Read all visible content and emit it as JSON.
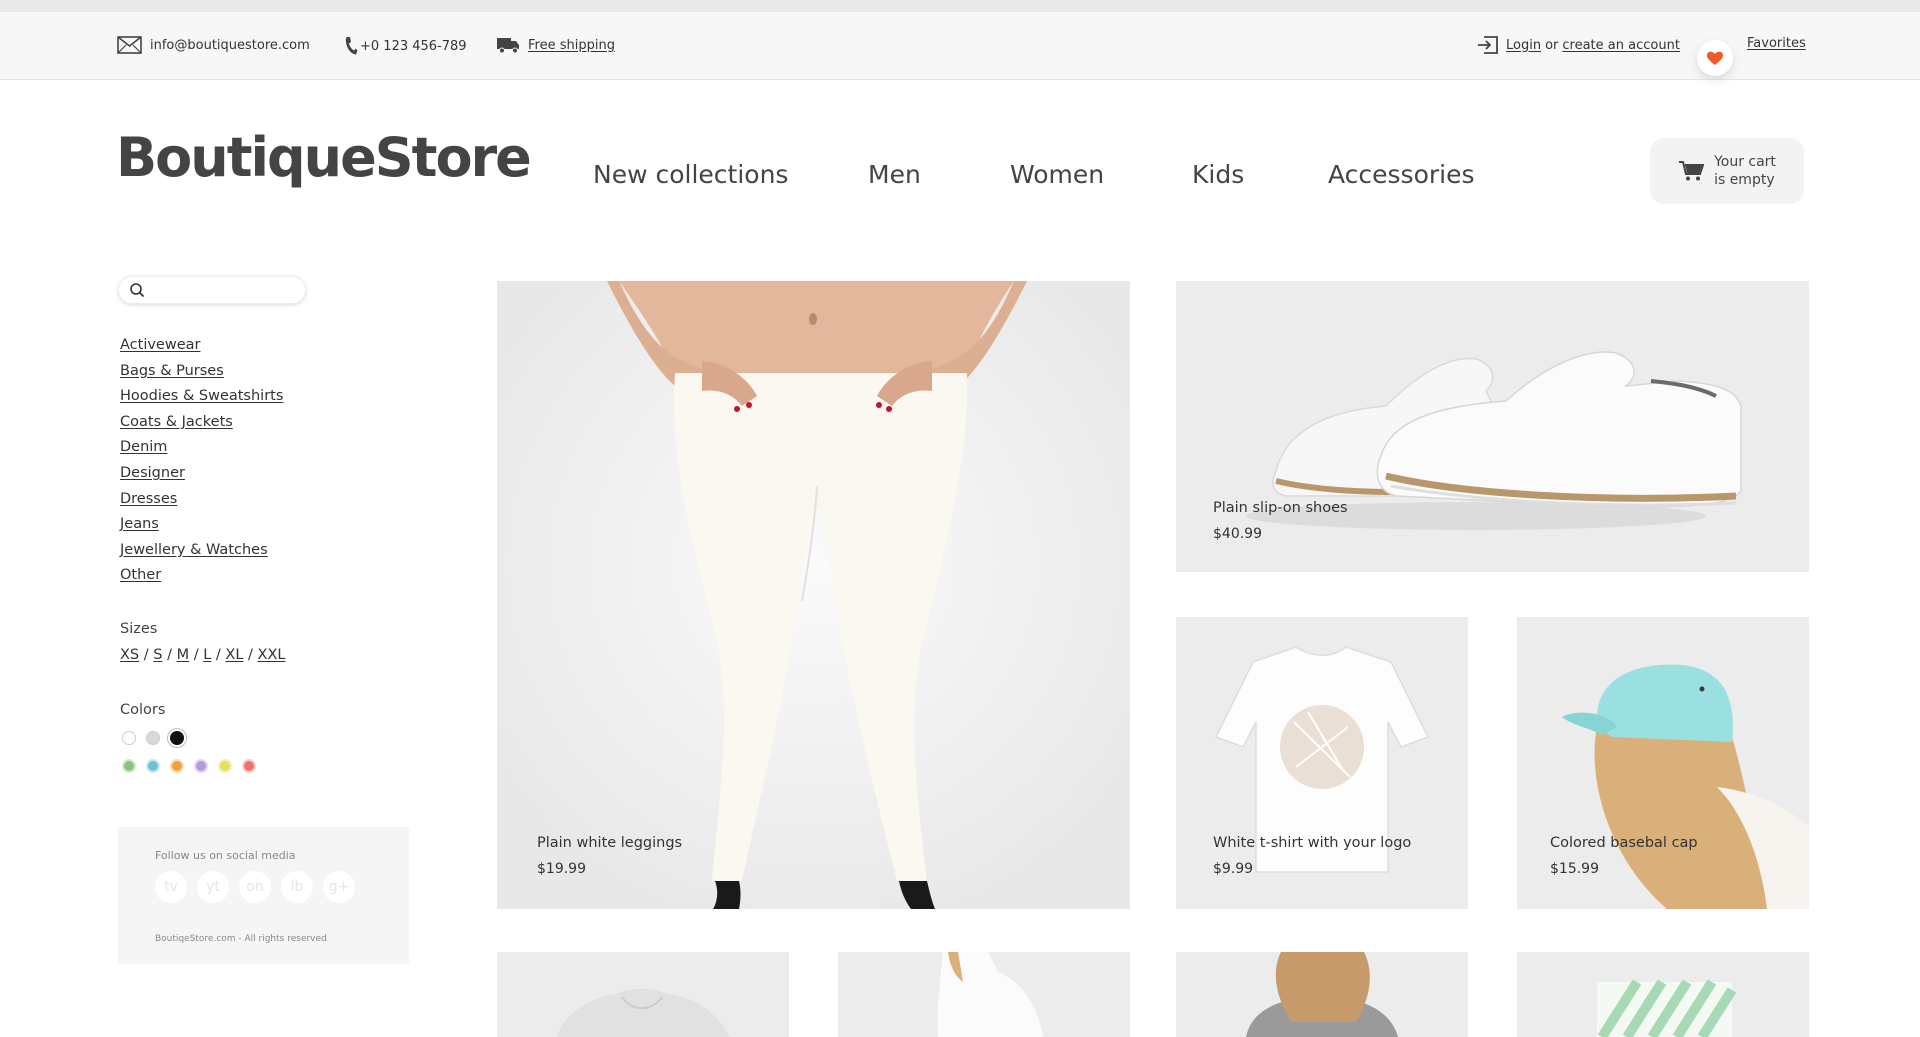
{
  "topbar": {
    "email": "info@boutiquestore.com",
    "phone": "+0 123 456-789",
    "shipping": "Free shipping",
    "login": "Login",
    "or": "or",
    "create_account": "create an account",
    "favorites": "Favorites"
  },
  "header": {
    "logo": "BoutiqueStore",
    "nav": [
      "New collections",
      "Men",
      "Women",
      "Kids",
      "Accessories"
    ],
    "cart_line1": "Your cart",
    "cart_line2": "is empty"
  },
  "sidebar": {
    "search_placeholder": "",
    "categories": [
      "Activewear",
      "Bags & Purses",
      "Hoodies & Sweatshirts",
      "Coats & Jackets",
      "Denim",
      "Designer",
      "Dresses",
      "Jeans",
      "Jewellery & Watches",
      "Other"
    ],
    "sizes_title": "Sizes",
    "sizes": [
      "XS",
      "S",
      "M",
      "L",
      "XL",
      "XXL"
    ],
    "colors_title": "Colors",
    "colors": [
      "#ffffff",
      "#d9d9d9",
      "#111111",
      "#8cc47a",
      "#6cc3d8",
      "#f2a03d",
      "#b79adf",
      "#e6e05a",
      "#f0706a"
    ],
    "social_title": "Follow us on social media",
    "social": [
      "tv",
      "yt",
      "on",
      "lb",
      "g+"
    ],
    "copyright": "BoutiqeStore.com - All rights reserved"
  },
  "products": [
    {
      "name": "Plain white leggings",
      "price": "$19.99"
    },
    {
      "name": "Plain slip-on shoes",
      "price": "$40.99"
    },
    {
      "name": "White t-shirt with your logo",
      "price": "$9.99"
    },
    {
      "name": "Colored basebal cap",
      "price": "$15.99"
    }
  ]
}
